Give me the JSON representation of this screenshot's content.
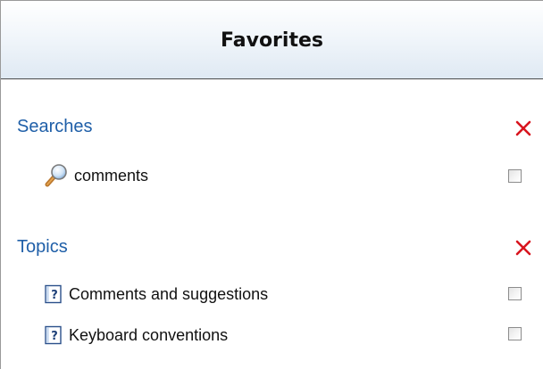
{
  "header": {
    "title": "Favorites"
  },
  "sections": [
    {
      "title": "Searches",
      "items": [
        {
          "label": "comments",
          "icon": "magnifier-icon",
          "checked": false
        }
      ]
    },
    {
      "title": "Topics",
      "items": [
        {
          "label": "Comments and suggestions",
          "icon": "help-topic-icon",
          "checked": false
        },
        {
          "label": "Keyboard conventions",
          "icon": "help-topic-icon",
          "checked": false
        }
      ]
    }
  ],
  "colors": {
    "section_title": "#1f5fa8",
    "clear_icon": "#d8141e",
    "header_border": "#4a4a4a"
  }
}
